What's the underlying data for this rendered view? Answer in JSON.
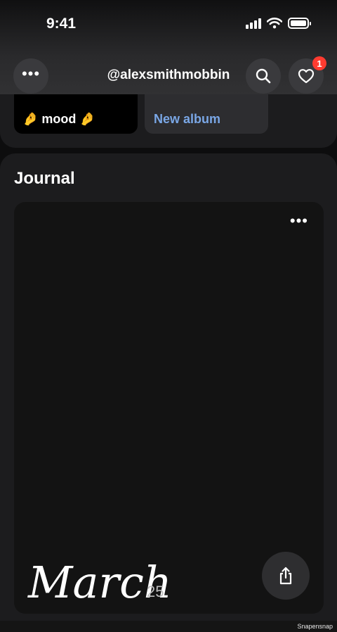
{
  "status_bar": {
    "time": "9:41"
  },
  "header": {
    "username": "@alexsmithmobbin",
    "notification_count": "1"
  },
  "albums": [
    {
      "label": "🤌 mood 🤌"
    },
    {
      "label": "New album"
    }
  ],
  "journal": {
    "title": "Journal",
    "entry": {
      "month": "March",
      "year": "25"
    }
  },
  "watermark": "Snapensnap",
  "colors": {
    "accent_link": "#7aa7e6",
    "badge": "#ff3b30"
  },
  "icons": [
    "more-icon",
    "search-icon",
    "heart-icon",
    "share-icon",
    "signal-icon",
    "wifi-icon",
    "battery-icon"
  ]
}
